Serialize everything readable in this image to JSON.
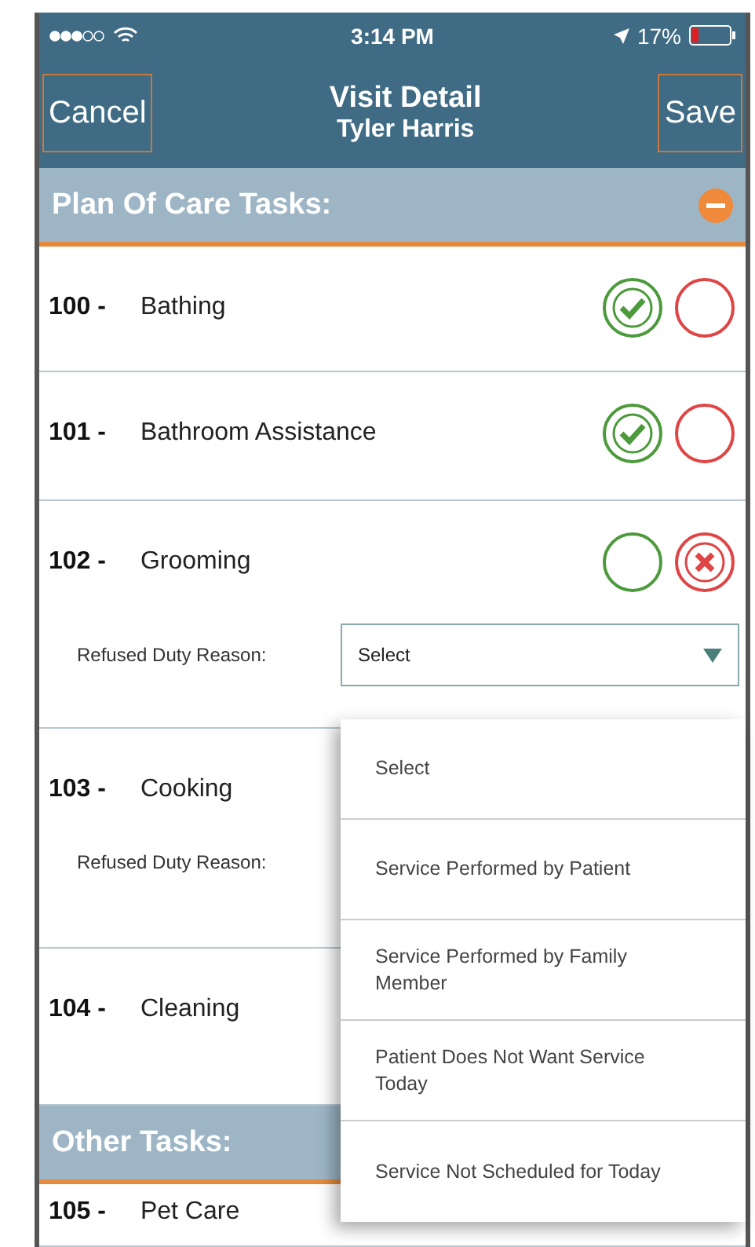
{
  "status_bar": {
    "time": "3:14 PM",
    "battery": "17%"
  },
  "nav": {
    "title": "Visit Detail",
    "subtitle": "Tyler Harris",
    "left_button": "Cancel",
    "right_button": "Save"
  },
  "sections": [
    {
      "title": "Plan Of Care Tasks:",
      "expanded": true,
      "tasks": [
        {
          "code": "100 -",
          "name": "Bathing",
          "done": true,
          "refused": false
        },
        {
          "code": "101 -",
          "name": "Bathroom Assistance",
          "done": true,
          "refused": false
        },
        {
          "code": "102 -",
          "name": "Grooming",
          "done": false,
          "refused": true,
          "reason_label": "Refused Duty Reason:",
          "reason_value": "Select"
        },
        {
          "code": "103 -",
          "name": "Cooking",
          "reason_label": "Refused Duty Reason:"
        },
        {
          "code": "104 -",
          "name": "Cleaning"
        }
      ]
    },
    {
      "title": "Other Tasks:",
      "tasks": [
        {
          "code": "105 -",
          "name": "Pet Care"
        }
      ]
    }
  ],
  "dropdown": {
    "options": [
      {
        "label": "Select"
      },
      {
        "label": "Service Performed by Patient"
      },
      {
        "label": "Service Performed by Family Member"
      },
      {
        "label": "Patient Does Not Want Service Today"
      },
      {
        "label": "Service Not Scheduled for Today"
      }
    ]
  }
}
